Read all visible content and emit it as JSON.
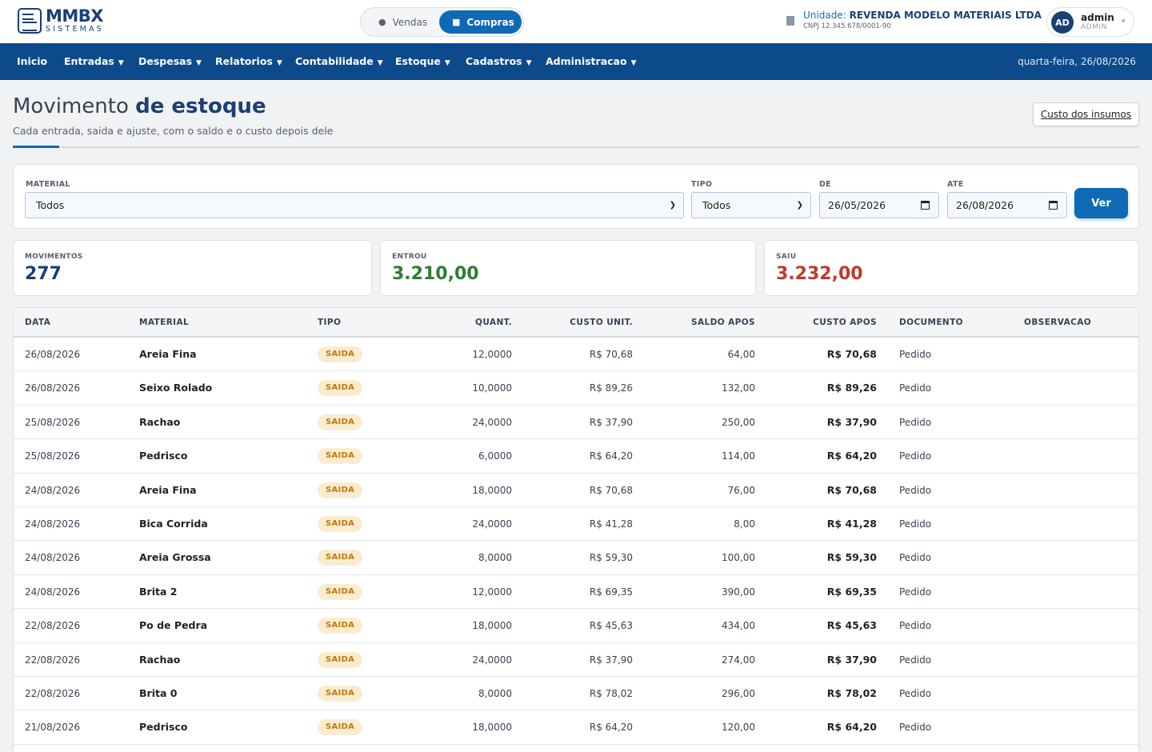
{
  "brand": {
    "name": "MMBX",
    "sub": "SISTEMAS"
  },
  "mode": {
    "vendas": "Vendas",
    "compras": "Compras",
    "active": "Compras"
  },
  "unit": {
    "prefix": "Unidade:",
    "name": "REVENDA MODELO MATERIAIS LTDA",
    "cnpj": "CNPJ 12.345.678/0001-90"
  },
  "user": {
    "initials": "AD",
    "name": "admin",
    "role": "ADMIN"
  },
  "nav": {
    "items": [
      "Inicio",
      "Entradas",
      "Despesas",
      "Relatorios",
      "Contabilidade",
      "Estoque",
      "Cadastros",
      "Administracao"
    ],
    "date": "quarta-feira, 26/08/2026"
  },
  "page": {
    "title_light": "Movimento",
    "title_bold": "de estoque",
    "subtitle": "Cada entrada, saida e ajuste, com o saldo e o custo depois dele",
    "cost_button": "Custo dos insumos"
  },
  "filters": {
    "material_label": "MATERIAL",
    "material_value": "Todos",
    "tipo_label": "TIPO",
    "tipo_value": "Todos",
    "de_label": "DE",
    "de_value": "26/05/2026",
    "ate_label": "ATE",
    "ate_value": "26/08/2026",
    "submit": "Ver"
  },
  "stats": {
    "movimentos_label": "MOVIMENTOS",
    "movimentos_value": "277",
    "entrou_label": "ENTROU",
    "entrou_value": "3.210,00",
    "saiu_label": "SAIU",
    "saiu_value": "3.232,00"
  },
  "colors": {
    "navy": "#1b3f73",
    "nav_bg": "#0c4a8c",
    "accent": "#0f6ab5",
    "green": "#2e7d32",
    "red": "#c0392b",
    "saida_bg": "#fbecd0",
    "saida_fg": "#c07a08"
  },
  "icons": {
    "vendas": "moneybag-icon",
    "compras": "box-icon",
    "unit": "building-icon",
    "calendar": "calendar-icon",
    "chevron": "chevron-down-icon"
  },
  "table": {
    "headers": [
      "DATA",
      "MATERIAL",
      "TIPO",
      "QUANT.",
      "CUSTO UNIT.",
      "SALDO APOS",
      "CUSTO APOS",
      "DOCUMENTO",
      "OBSERVACAO"
    ],
    "rows": [
      {
        "data": "26/08/2026",
        "material": "Areia Fina",
        "tipo": "SAIDA",
        "quant": "12,0000",
        "custo_unit": "R$ 70,68",
        "saldo": "64,00",
        "custo_apos": "R$ 70,68",
        "documento": "Pedido",
        "obs": ""
      },
      {
        "data": "26/08/2026",
        "material": "Seixo Rolado",
        "tipo": "SAIDA",
        "quant": "10,0000",
        "custo_unit": "R$ 89,26",
        "saldo": "132,00",
        "custo_apos": "R$ 89,26",
        "documento": "Pedido",
        "obs": ""
      },
      {
        "data": "25/08/2026",
        "material": "Rachao",
        "tipo": "SAIDA",
        "quant": "24,0000",
        "custo_unit": "R$ 37,90",
        "saldo": "250,00",
        "custo_apos": "R$ 37,90",
        "documento": "Pedido",
        "obs": ""
      },
      {
        "data": "25/08/2026",
        "material": "Pedrisco",
        "tipo": "SAIDA",
        "quant": "6,0000",
        "custo_unit": "R$ 64,20",
        "saldo": "114,00",
        "custo_apos": "R$ 64,20",
        "documento": "Pedido",
        "obs": ""
      },
      {
        "data": "24/08/2026",
        "material": "Areia Fina",
        "tipo": "SAIDA",
        "quant": "18,0000",
        "custo_unit": "R$ 70,68",
        "saldo": "76,00",
        "custo_apos": "R$ 70,68",
        "documento": "Pedido",
        "obs": ""
      },
      {
        "data": "24/08/2026",
        "material": "Bica Corrida",
        "tipo": "SAIDA",
        "quant": "24,0000",
        "custo_unit": "R$ 41,28",
        "saldo": "8,00",
        "custo_apos": "R$ 41,28",
        "documento": "Pedido",
        "obs": ""
      },
      {
        "data": "24/08/2026",
        "material": "Areia Grossa",
        "tipo": "SAIDA",
        "quant": "8,0000",
        "custo_unit": "R$ 59,30",
        "saldo": "100,00",
        "custo_apos": "R$ 59,30",
        "documento": "Pedido",
        "obs": ""
      },
      {
        "data": "24/08/2026",
        "material": "Brita 2",
        "tipo": "SAIDA",
        "quant": "12,0000",
        "custo_unit": "R$ 69,35",
        "saldo": "390,00",
        "custo_apos": "R$ 69,35",
        "documento": "Pedido",
        "obs": ""
      },
      {
        "data": "22/08/2026",
        "material": "Po de Pedra",
        "tipo": "SAIDA",
        "quant": "18,0000",
        "custo_unit": "R$ 45,63",
        "saldo": "434,00",
        "custo_apos": "R$ 45,63",
        "documento": "Pedido",
        "obs": ""
      },
      {
        "data": "22/08/2026",
        "material": "Rachao",
        "tipo": "SAIDA",
        "quant": "24,0000",
        "custo_unit": "R$ 37,90",
        "saldo": "274,00",
        "custo_apos": "R$ 37,90",
        "documento": "Pedido",
        "obs": ""
      },
      {
        "data": "22/08/2026",
        "material": "Brita 0",
        "tipo": "SAIDA",
        "quant": "8,0000",
        "custo_unit": "R$ 78,02",
        "saldo": "296,00",
        "custo_apos": "R$ 78,02",
        "documento": "Pedido",
        "obs": ""
      },
      {
        "data": "21/08/2026",
        "material": "Pedrisco",
        "tipo": "SAIDA",
        "quant": "18,0000",
        "custo_unit": "R$ 64,20",
        "saldo": "120,00",
        "custo_apos": "R$ 64,20",
        "documento": "Pedido",
        "obs": ""
      }
    ]
  }
}
